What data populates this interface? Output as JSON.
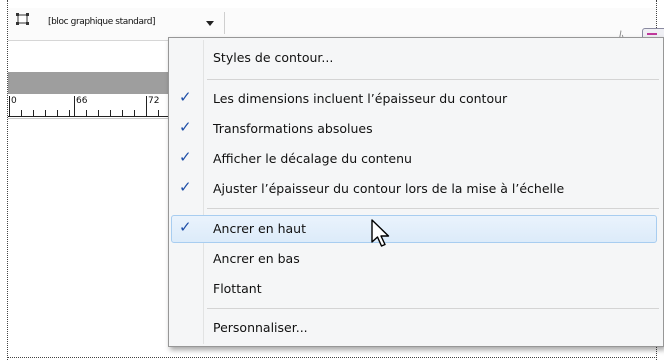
{
  "control_bar": {
    "style_dropdown_value": "[bloc graphique standard]",
    "style_icon": "frame-style-icon",
    "dropdown_arrow_icon": "dropdown-arrow-icon",
    "right_glyph": "ﾑ",
    "panel_menu_icon": "panel-menu-icon"
  },
  "ruler": {
    "labels": [
      "0",
      "66",
      "72"
    ]
  },
  "menu": {
    "items": [
      {
        "label": "Styles de contour...",
        "checked": false
      },
      {
        "label": "Les dimensions incluent l’épaisseur du contour",
        "checked": true
      },
      {
        "label": "Transformations absolues",
        "checked": true
      },
      {
        "label": "Afficher le décalage du contenu",
        "checked": true
      },
      {
        "label": "Ajuster l’épaisseur du contour lors de la mise à l’échelle",
        "checked": true
      },
      {
        "label": "Ancrer en haut",
        "checked": true,
        "highlighted": true
      },
      {
        "label": "Ancrer en bas",
        "checked": false
      },
      {
        "label": "Flottant",
        "checked": false
      },
      {
        "label": "Personnaliser...",
        "checked": false
      }
    ],
    "check_glyph": "✓"
  },
  "colors": {
    "check": "#1f4fa8",
    "highlight": "#dcebfa",
    "toolbar_strip": "#9e9e9e",
    "panel_menu_accent": "#c0399b"
  }
}
